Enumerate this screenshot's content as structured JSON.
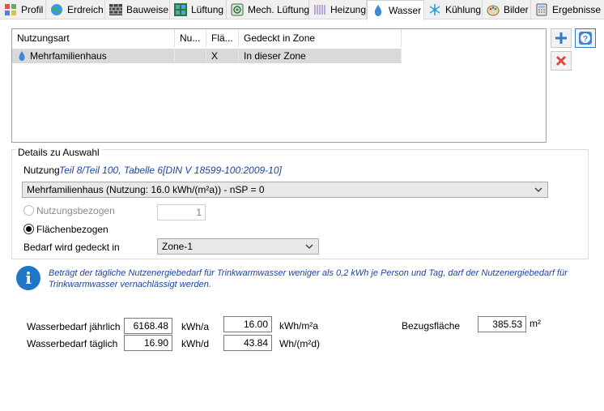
{
  "tabs": [
    {
      "label": "Profil",
      "icon": "profile-icon"
    },
    {
      "label": "Erdreich",
      "icon": "globe-icon"
    },
    {
      "label": "Bauweise",
      "icon": "brick-wall-icon"
    },
    {
      "label": "Lüftung",
      "icon": "window-icon"
    },
    {
      "label": "Mech. Lüftung",
      "icon": "fan-icon"
    },
    {
      "label": "Heizung",
      "icon": "radiator-icon"
    },
    {
      "label": "Wasser",
      "icon": "water-drop-icon"
    },
    {
      "label": "Kühlung",
      "icon": "snowflake-icon"
    },
    {
      "label": "Bilder",
      "icon": "palette-icon"
    },
    {
      "label": "Ergebnisse",
      "icon": "calculator-icon"
    }
  ],
  "active_tab": "Wasser",
  "grid": {
    "headers": [
      "Nutzungsart",
      "Nu...",
      "Flä...",
      "Gedeckt in Zone"
    ],
    "rows": [
      {
        "nutzungsart": "Mehrfamilienhaus",
        "nu": "",
        "flae": "X",
        "zone": "In dieser Zone"
      }
    ]
  },
  "details": {
    "legend": "Details zu Auswahl",
    "nutzung_label": "Nutzung",
    "nutzung_ref": "Teil 8/Teil 100, Tabelle 6[DIN V 18599-100:2009-10]",
    "usage_select": "Mehrfamilienhaus (Nutzung: 16.0 kWh/(m²a)) - nSP = 0",
    "radio_nutzungsbezogen": "Nutzungsbezogen",
    "nutzungsbezogen_value": "1",
    "radio_flaechenbezogen": "Flächenbezogen",
    "bedarf_label": "Bedarf wird gedeckt in",
    "zone_select": "Zone-1"
  },
  "info": {
    "text_line1": "Beträgt der tägliche Nutzenergiebedarf für Trinkwarmwasser weniger als 0,2 kWh je Person und Tag, darf der Nutzenergiebedarf für",
    "text_line2": "Trinkwarmwasser vernachlässigt werden."
  },
  "results": {
    "jaehrlich_label": "Wasserbedarf jährlich",
    "jaehrlich_value": "6168.48",
    "jaehrlich_unit": "kWh/a",
    "taeglich_label": "Wasserbedarf täglich",
    "taeglich_value": "16.90",
    "taeglich_unit": "kWh/d",
    "spec_value": "16.00",
    "spec_unit": "kWh/m²a",
    "spec2_value": "43.84",
    "spec2_unit": "Wh/(m²d)",
    "bezug_label": "Bezugsfläche",
    "bezug_value": "385.53",
    "bezug_unit": "m²"
  }
}
